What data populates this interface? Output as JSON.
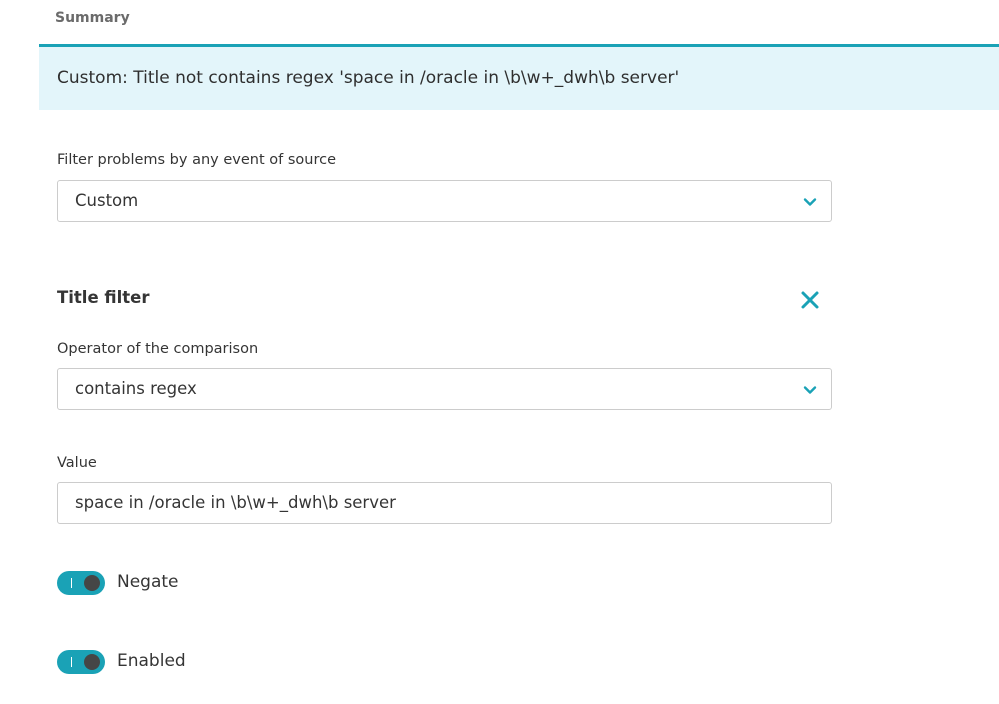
{
  "summary": {
    "label": "Summary",
    "text": "Custom: Title not contains regex 'space in /oracle in \\b\\w+_dwh\\b server'"
  },
  "source_filter": {
    "label": "Filter problems by any event of source",
    "selected": "Custom",
    "icon": "chevron-down-icon"
  },
  "title_filter": {
    "title": "Title filter",
    "remove_icon": "close-icon",
    "operator": {
      "label": "Operator of the comparison",
      "selected": "contains regex",
      "icon": "chevron-down-icon"
    },
    "value": {
      "label": "Value",
      "text": "space in /oracle in \\b\\w+_dwh\\b server"
    },
    "negate": {
      "label": "Negate",
      "on": true
    },
    "enabled": {
      "label": "Enabled",
      "on": true
    }
  },
  "colors": {
    "accent": "#1aa2b6",
    "summary_bg": "#e3f5fa",
    "knob": "#454646"
  }
}
